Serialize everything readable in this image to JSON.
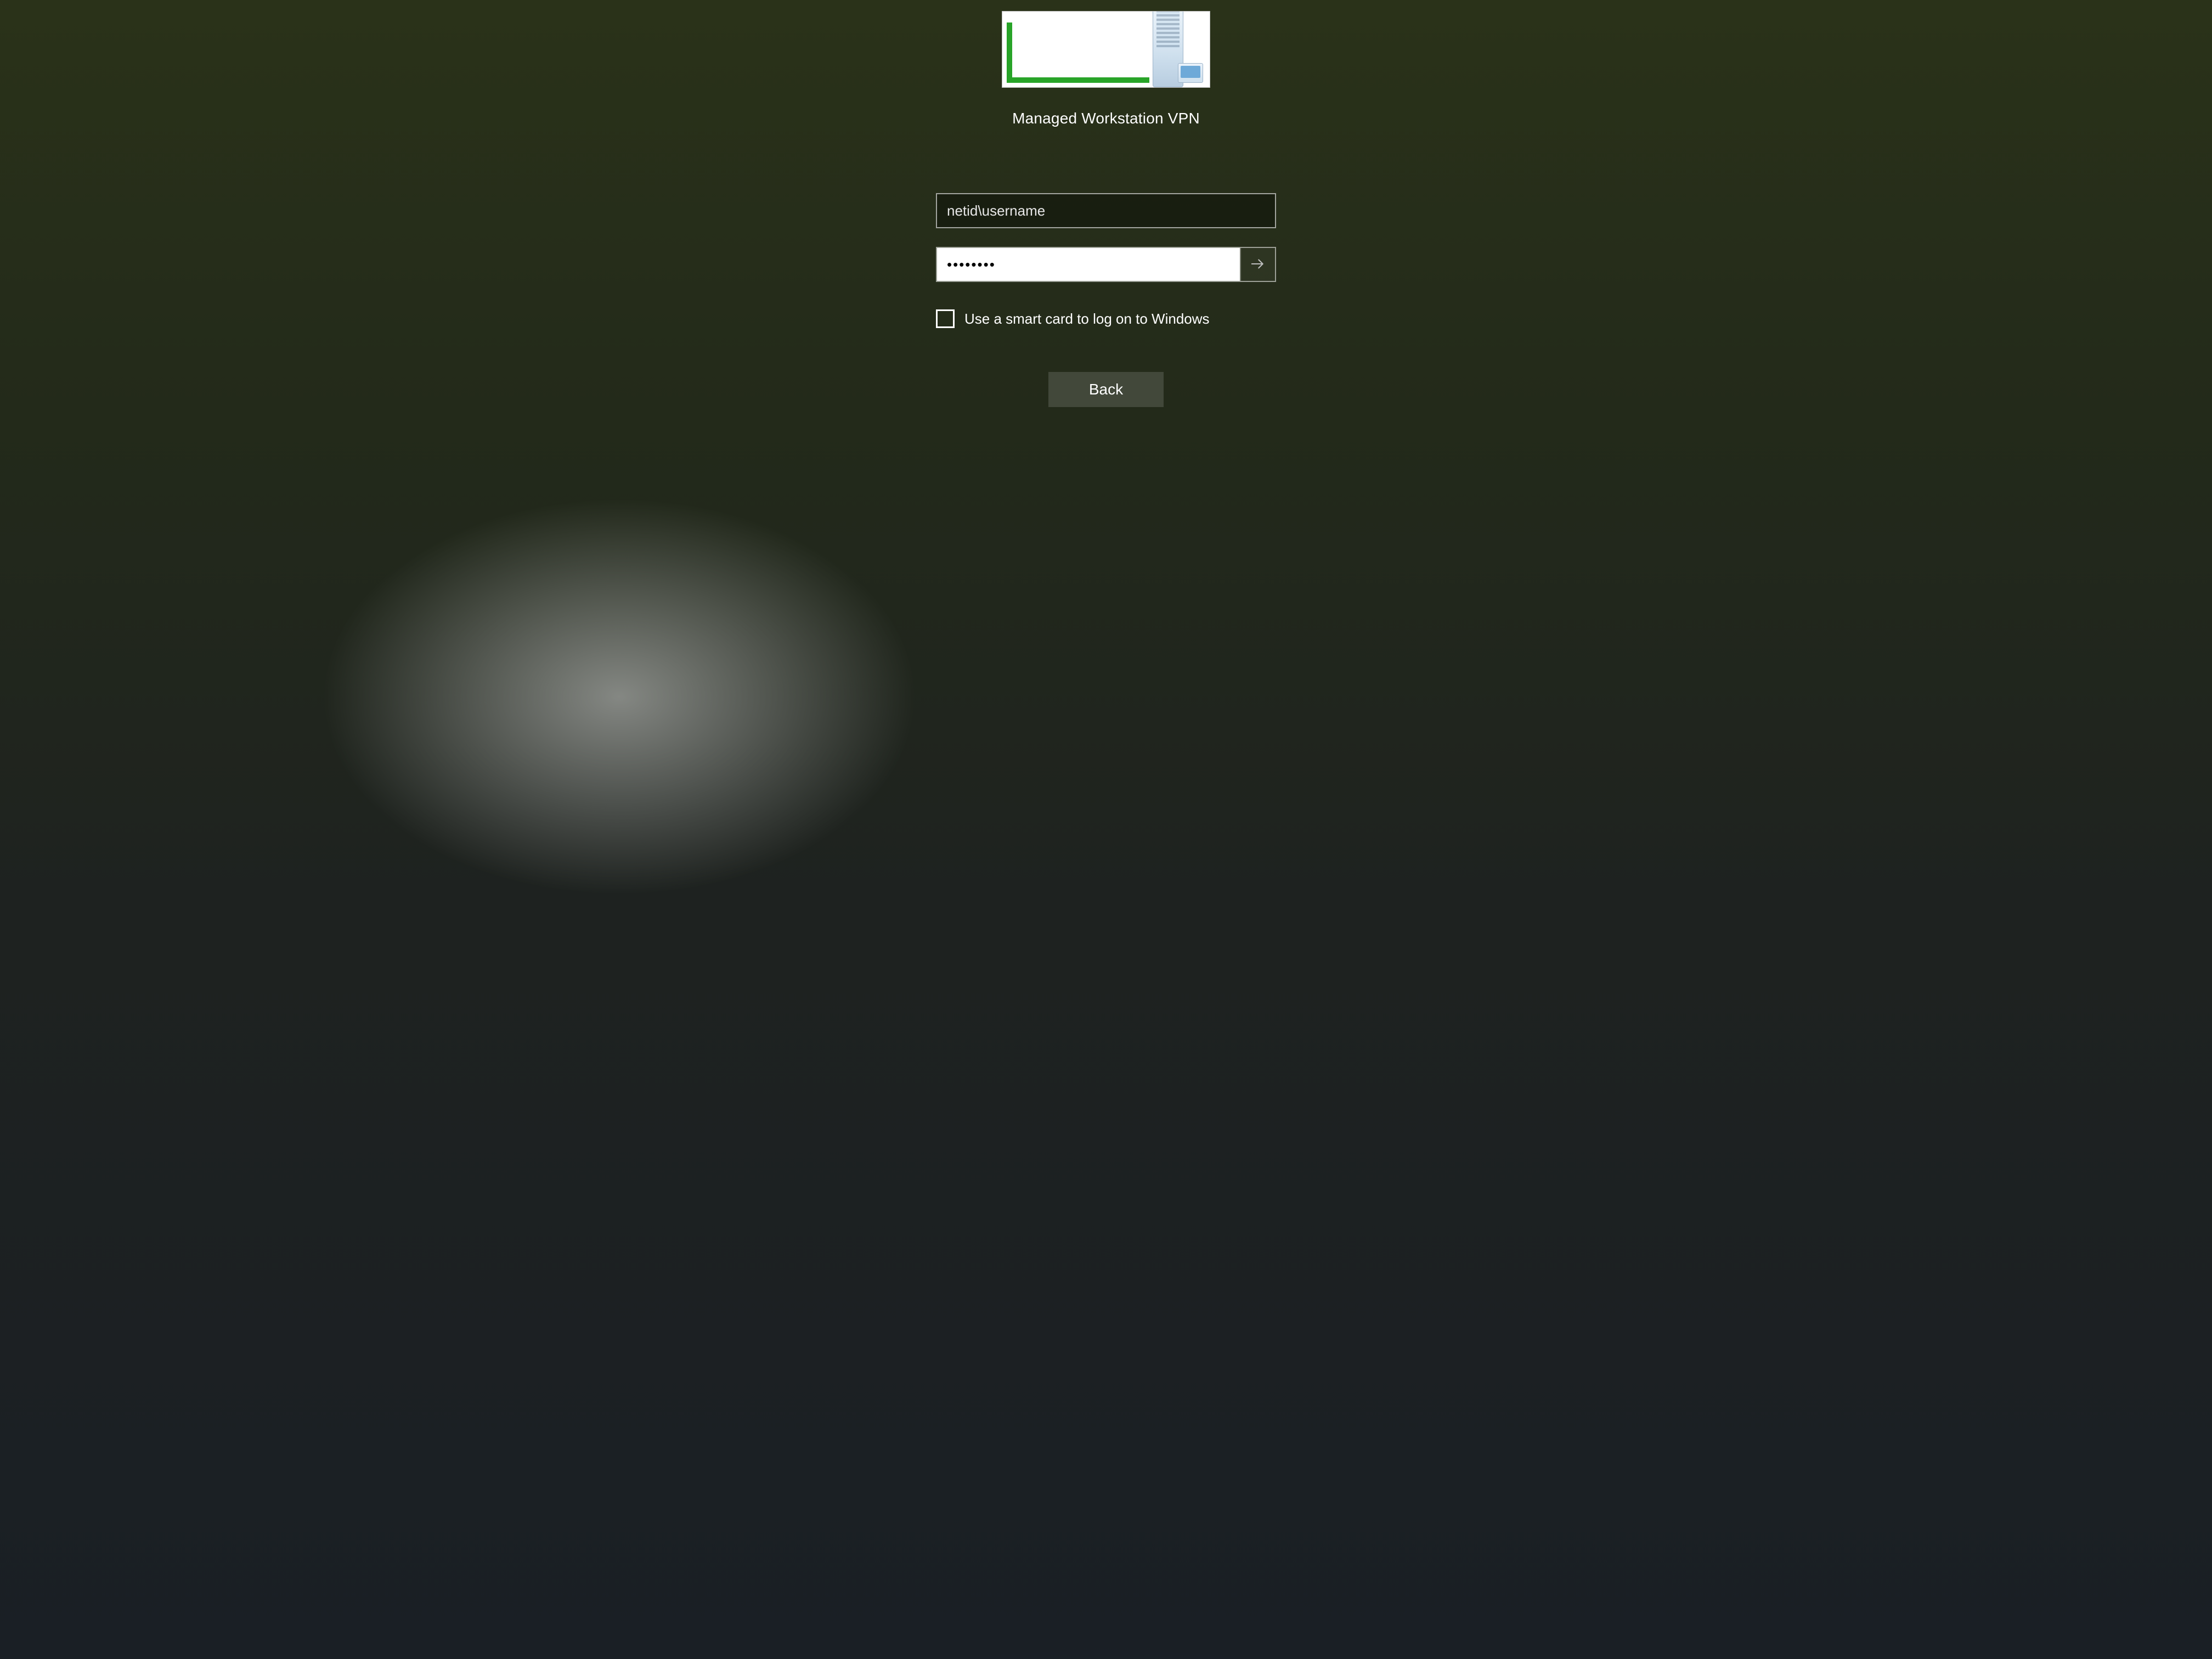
{
  "login": {
    "tile_icon": "vpn-server-icon",
    "title": "Managed Workstation VPN",
    "username_value": "netid\\username",
    "username_placeholder": "",
    "password_value": "••••••••",
    "password_placeholder": "",
    "password_masked_length": 8,
    "submit_icon": "arrow-right-icon",
    "smartcard_checked": false,
    "smartcard_label": "Use a smart card to log on to Windows",
    "back_label": "Back"
  }
}
